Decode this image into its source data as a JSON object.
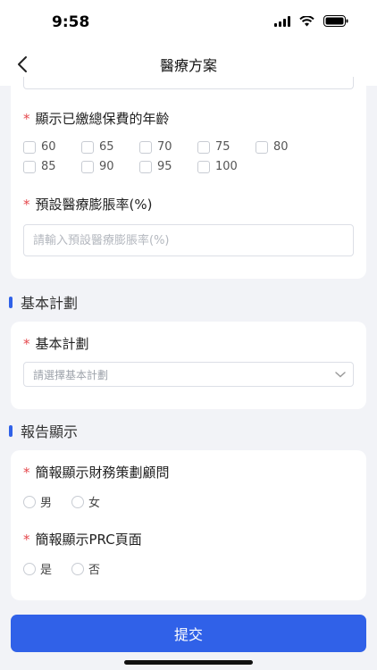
{
  "status_bar": {
    "time": "9:58"
  },
  "nav": {
    "title": "醫療方案"
  },
  "paid_age": {
    "label": "顯示已繳總保費的年齡",
    "options": [
      "60",
      "65",
      "70",
      "75",
      "80",
      "85",
      "90",
      "95",
      "100"
    ]
  },
  "inflation": {
    "label": "預設醫療膨脹率(%)",
    "placeholder": "請輸入預設醫療膨脹率(%)"
  },
  "basic_plan_section": {
    "title": "基本計劃"
  },
  "basic_plan": {
    "label": "基本計劃",
    "placeholder": "請選擇基本計劃"
  },
  "report_section": {
    "title": "報告顯示"
  },
  "advisor": {
    "label": "簡報顯示財務策劃顧問",
    "options": [
      "男",
      "女"
    ]
  },
  "prc_page": {
    "label": "簡報顯示PRC頁面",
    "options": [
      "是",
      "否"
    ]
  },
  "submit": {
    "label": "提交"
  },
  "colors": {
    "accent": "#3061e8",
    "required": "#e5484d",
    "background": "#f2f3f7"
  }
}
